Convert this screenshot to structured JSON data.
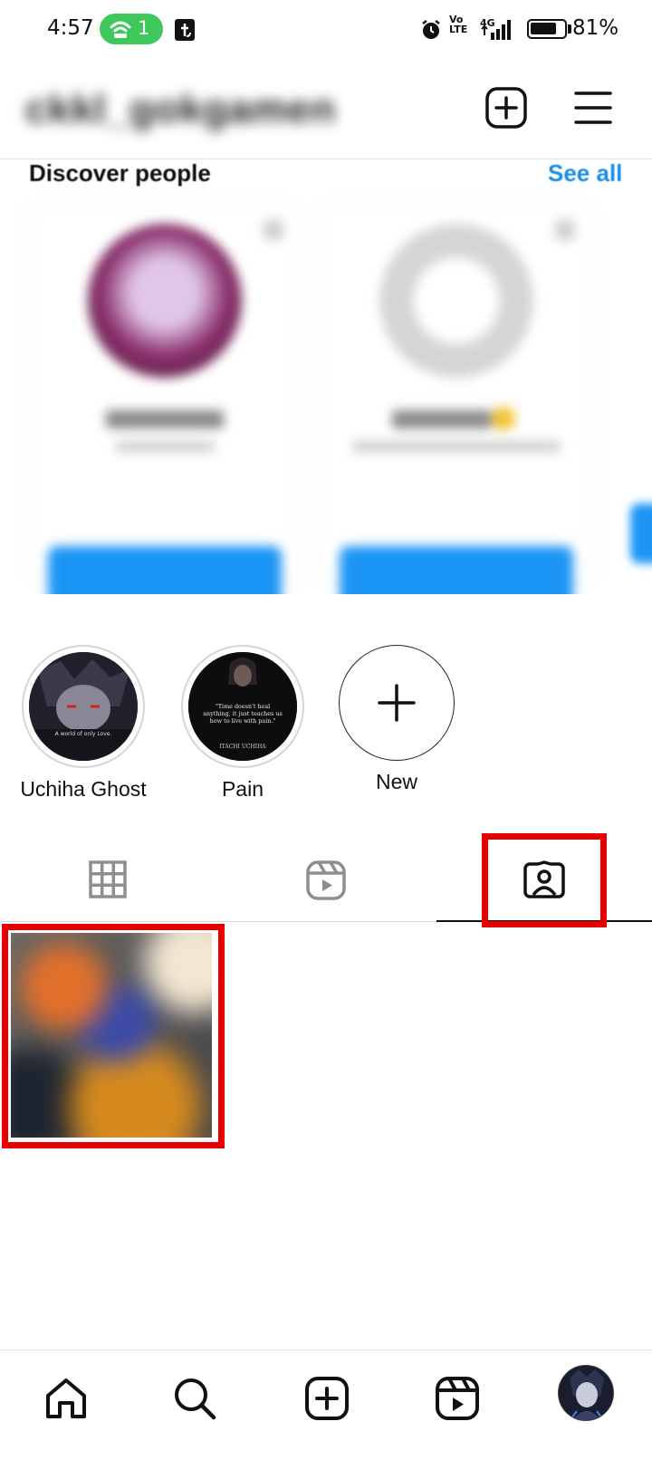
{
  "status_bar": {
    "time": "4:57",
    "hotspot_count": "1",
    "network": "4G",
    "volte_line1": "Vo",
    "volte_line2": "LTE",
    "battery": "81%",
    "battery_level": 0.81
  },
  "header": {
    "username": "ckkl_gokgamen",
    "icons": [
      "new-post-icon",
      "menu-icon"
    ]
  },
  "discover": {
    "title": "Discover people",
    "see_all": "See all"
  },
  "highlights": [
    {
      "label": "Uchiha Ghost",
      "caption": "A world of only Love."
    },
    {
      "label": "Pain",
      "quote": "\"Time doesn't heal anything, it just teaches us how to live with pain.\"",
      "author": "ITACHI UCHIHA"
    },
    {
      "label": "New"
    }
  ],
  "tabs": {
    "items": [
      "posts-grid-icon",
      "reels-icon",
      "tagged-icon"
    ],
    "active": "tagged"
  },
  "bottom_nav": {
    "items": [
      "home-icon",
      "search-icon",
      "create-icon",
      "reels-icon",
      "profile-avatar"
    ]
  },
  "colors": {
    "accent": "#1a8fe3",
    "follow_button": "#1b95f5",
    "highlight_box": "#e60000",
    "hotspot": "#3ec85b"
  }
}
